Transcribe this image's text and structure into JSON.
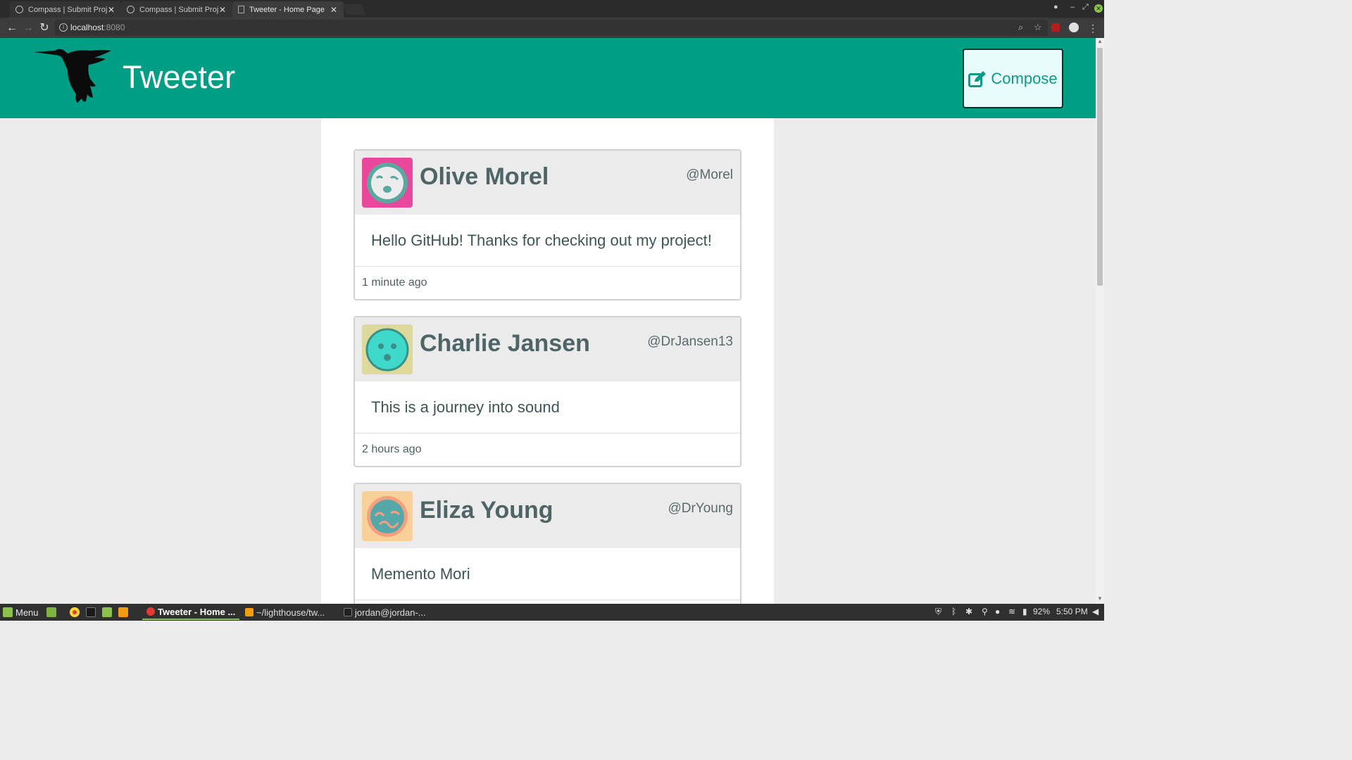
{
  "browser": {
    "tabs": [
      {
        "title": "Compass | Submit Proj",
        "active": false
      },
      {
        "title": "Compass | Submit Proj",
        "active": false
      },
      {
        "title": "Tweeter - Home Page",
        "active": true
      }
    ],
    "url_host": "localhost",
    "url_port": ":8080"
  },
  "header": {
    "title": "Tweeter",
    "compose_label": "Compose",
    "color": "#009e84"
  },
  "tweets": [
    {
      "name": "Olive Morel",
      "handle": "@Morel",
      "text": "Hello GitHub! Thanks for checking out my project!",
      "time": "1 minute ago",
      "avatar_bg": "#e8479c",
      "avatar_face": "#5ba8a0"
    },
    {
      "name": "Charlie Jansen",
      "handle": "@DrJansen13",
      "text": "This is a journey into sound",
      "time": "2 hours ago",
      "avatar_bg": "#dcd99a",
      "avatar_face": "#3fd9cc"
    },
    {
      "name": "Eliza Young",
      "handle": "@DrYoung",
      "text": "Memento Mori",
      "time": "",
      "avatar_bg": "#fbcf98",
      "avatar_face": "#55a8a8"
    }
  ],
  "taskbar": {
    "menu_label": "Menu",
    "windows": [
      {
        "label": "Tweeter - Home ...",
        "active": true
      },
      {
        "label": "~/lighthouse/tw...",
        "active": false
      },
      {
        "label": "jordan@jordan-...",
        "active": false
      }
    ],
    "battery": "92%",
    "clock": "5:50 PM"
  }
}
